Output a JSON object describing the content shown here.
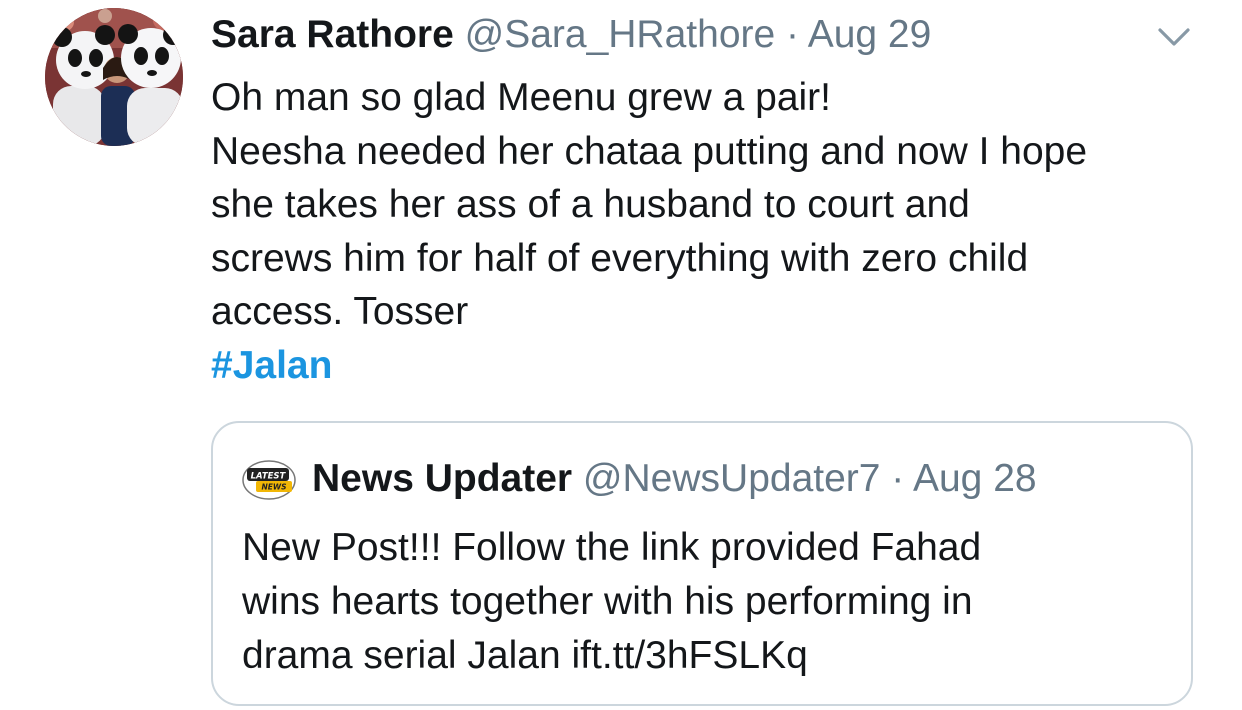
{
  "tweet": {
    "author_name": "Sara Rathore",
    "handle": "@Sara_HRathore",
    "separator": " · ",
    "date": "Aug 29",
    "avatar_icon": "panda-costume-photo-avatar",
    "caret_icon": "chevron-down-icon",
    "text_lines": [
      "Oh man so glad Meenu grew a pair!",
      "Neesha needed her chataa putting and now I hope",
      "she takes her ass of a husband to court and",
      "screws him for half of everything with zero child",
      "access. Tosser"
    ],
    "hashtag": "#Jalan",
    "hashtag_color": "#1b95e0"
  },
  "quoted_tweet": {
    "author_name": "News Updater",
    "handle": "@NewsUpdater7",
    "separator": " · ",
    "date": "Aug 28",
    "avatar_icon": "latest-news-logo",
    "text_lines": [
      "New Post!!! Follow the link provided  Fahad",
      "wins hearts together with his performing in",
      "drama serial Jalan ift.tt/3hFSLKq"
    ]
  },
  "colors": {
    "primary_text": "#14171a",
    "secondary_text": "#657786",
    "border": "#ccd6dd",
    "link": "#1b95e0"
  }
}
